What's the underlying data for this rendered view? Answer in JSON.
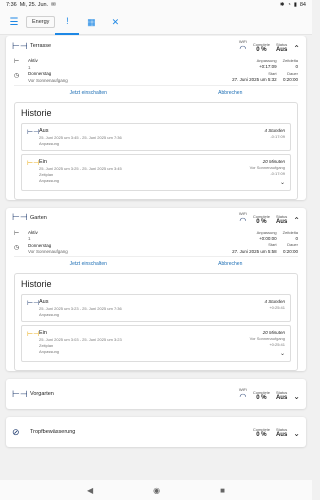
{
  "status": {
    "time": "7:36",
    "date": "Mi, 25. Jun.",
    "battery": "84"
  },
  "appbar": {
    "title": "Energy"
  },
  "cards": [
    {
      "name": "Terrasse",
      "wifi_label": "WiFi",
      "complete_label": "Complete",
      "complete_value": "0 %",
      "status_label": "Status",
      "status_value": "Aus",
      "active_label": "Aktiv",
      "active_value": "1",
      "repeat_label": "Donnerstag",
      "repeat_sub": "Vor Sonnenaufgang",
      "offset_label": "Anpassung",
      "offset_value": "+0:17:09",
      "zone_label": "Zeitdelta",
      "zone_value": "0",
      "start_label": "Start",
      "start_value": "27. Juni 2025 um 5:32",
      "duration_label": "Dauer",
      "duration_value": "0:20:00",
      "action_now": "Jetzt einschalten",
      "action_cancel": "Abbrechen",
      "history_title": "Historie",
      "history": [
        {
          "state": "Aus",
          "range": "25. Juni 2025 um 3:45 - 25. Juni 2025 um 7:36",
          "sub": "Anpassung",
          "duration": "4 Stunden",
          "right_sub": "",
          "right_val": "-0:17:09"
        },
        {
          "state": "Ein",
          "range": "25. Juni 2025 um 3:25 - 25. Juni 2025 um 3:45",
          "sub": "Zeitplan",
          "sub2": "Anpassung",
          "duration": "20 Minuten",
          "right_sub": "Vor Sonnenaufgang",
          "right_val": "-0:17:09"
        }
      ]
    },
    {
      "name": "Garten",
      "wifi_label": "WiFi",
      "complete_label": "Complete",
      "complete_value": "0 %",
      "status_label": "Status",
      "status_value": "Aus",
      "active_label": "Aktiv",
      "active_value": "1",
      "repeat_label": "Donnerstag",
      "repeat_sub": "Vor Sonnenaufgang",
      "offset_label": "Anpassung",
      "offset_value": "+0:00:00",
      "zone_label": "Zeitdelta",
      "zone_value": "0",
      "start_label": "Start",
      "start_value": "27. Juni 2025 um 5:58",
      "duration_label": "Dauer",
      "duration_value": "0:20:00",
      "action_now": "Jetzt einschalten",
      "action_cancel": "Abbrechen",
      "history_title": "Historie",
      "history": [
        {
          "state": "Aus",
          "range": "25. Juni 2025 um 3:23 - 25. Juni 2025 um 7:36",
          "sub": "Anpassung",
          "duration": "4 Stunden",
          "right_sub": "",
          "right_val": "+0:25:41"
        },
        {
          "state": "Ein",
          "range": "25. Juni 2025 um 3:03 - 25. Juni 2025 um 3:23",
          "sub": "Zeitplan",
          "sub2": "Anpassung",
          "duration": "20 Minuten",
          "right_sub": "Vor Sonnenaufgang",
          "right_val": "+0:25:41"
        }
      ]
    }
  ],
  "collapsed": [
    {
      "name": "Vorgarten",
      "wifi_label": "WiFi",
      "complete_label": "Complete",
      "complete_value": "0 %",
      "status_label": "Status",
      "status_value": "Aus"
    },
    {
      "name": "Tropfbewässerung",
      "complete_label": "Complete",
      "complete_value": "0 %",
      "status_label": "Status",
      "status_value": "Aus"
    }
  ],
  "icons": {
    "menu": "hamburger-menu-icon",
    "valve": "valve-icon",
    "wifi": "wifi-icon",
    "chevron": "chevron-icon",
    "history_off": "valve-off-icon",
    "history_on": "valve-on-icon"
  },
  "colors": {
    "accent": "#1e88e5",
    "valve": "#1e3a6e",
    "on": "#e8a500"
  }
}
